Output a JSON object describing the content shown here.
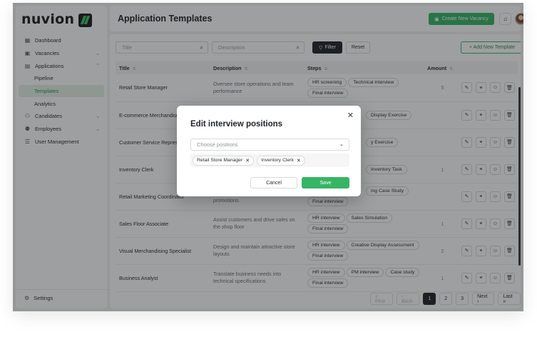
{
  "brand": {
    "name": "nuvion"
  },
  "sidebar": {
    "items": [
      {
        "label": "Dashboard",
        "icon": "grid-icon",
        "chevron": false
      },
      {
        "label": "Vacancies",
        "icon": "briefcase-icon",
        "chevron": true
      },
      {
        "label": "Applications",
        "icon": "clipboard-icon",
        "chevron": true
      },
      {
        "label": "Pipeline",
        "sub": true
      },
      {
        "label": "Templates",
        "sub": true,
        "active": true
      },
      {
        "label": "Analytics",
        "sub": true
      },
      {
        "label": "Candidates",
        "icon": "users-icon",
        "chevron": true
      },
      {
        "label": "Employees",
        "icon": "user-group-icon",
        "chevron": true
      },
      {
        "label": "User Management",
        "icon": "sliders-icon",
        "chevron": false
      }
    ],
    "settings_label": "Settings"
  },
  "header": {
    "title": "Application Templates",
    "create_button": "Create New Vacancy"
  },
  "filters": {
    "title_placeholder": "Title",
    "description_placeholder": "Description",
    "filter_label": "Filter",
    "reset_label": "Reset",
    "add_template_label": "+ Add New Template"
  },
  "table": {
    "columns": [
      "Title",
      "Description",
      "Steps",
      "Amount"
    ],
    "rows": [
      {
        "title": "Retail Store Manager",
        "description": "Oversee store operations and team performance",
        "steps": [
          "HR screening",
          "Technical interview",
          "Final interview"
        ],
        "amount": "5"
      },
      {
        "title": "E-commerce Merchandiser",
        "description": "",
        "steps": [
          "Display Exercise"
        ],
        "amount": ""
      },
      {
        "title": "Customer Service Representative",
        "description": "",
        "steps": [
          "y Exercise"
        ],
        "amount": ""
      },
      {
        "title": "Inventory Clerk",
        "description": "",
        "steps": [
          "Inventory Task"
        ],
        "amount": "1"
      },
      {
        "title": "Retail Marketing Coordinator",
        "description": "promotions",
        "steps": [
          "ing Case Study",
          "Final interview"
        ],
        "amount": ""
      },
      {
        "title": "Sales Floor Associate",
        "description": "Assist customers and drive sales on the shop floor",
        "steps": [
          "HR interview",
          "Sales Simulation",
          "Final interview"
        ],
        "amount": "1"
      },
      {
        "title": "Visual Merchandising Specialist",
        "description": "Design and maintain attractive store layouts",
        "steps": [
          "HR interview",
          "Creative Display Assessment",
          "Final interview"
        ],
        "amount": "2"
      },
      {
        "title": "Business Analyst",
        "description": "Translate business needs into technical specifications",
        "steps": [
          "HR interview",
          "PM interview",
          "Case study",
          "Final interview"
        ],
        "amount": "1"
      }
    ]
  },
  "pagination": {
    "first": "« First",
    "back": "‹ Back",
    "pages": [
      "1",
      "2",
      "3"
    ],
    "next": "Next ›",
    "last": "Last »",
    "current": "1"
  },
  "modal": {
    "title": "Edit interview positions",
    "select_placeholder": "Choose positions",
    "selected": [
      "Retail Store Manager",
      "Inventory Clerk"
    ],
    "cancel_label": "Cancel",
    "save_label": "Save"
  },
  "colors": {
    "accent": "#36b564",
    "dark": "#1f2328"
  }
}
